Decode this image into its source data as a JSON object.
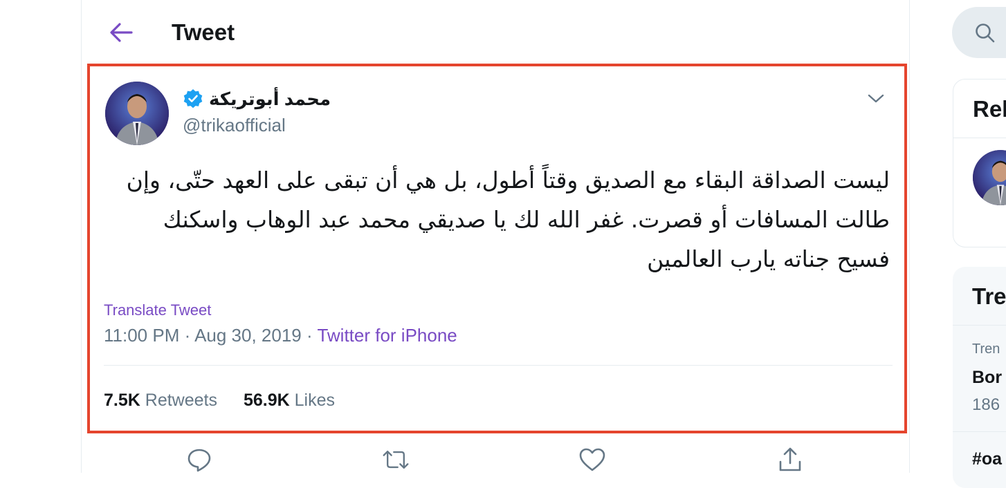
{
  "header": {
    "title": "Tweet"
  },
  "tweet": {
    "author_name": "محمد أبوتريكة",
    "handle": "@trikaofficial",
    "text": "ليست الصداقة البقاء مع الصديق وقتاً أطول، بل هي أن تبقى على العهد حتّى، وإن طالت المسافات أو قصرت.   غفر الله لك يا صديقي محمد عبد الوهاب واسكنك فسيح جناته يارب العالمين",
    "translate_label": "Translate Tweet",
    "time": "11:00 PM",
    "date": "Aug 30, 2019",
    "separator": "·",
    "source": "Twitter for iPhone",
    "retweets_count": "7.5K",
    "retweets_label": "Retweets",
    "likes_count": "56.9K",
    "likes_label": "Likes"
  },
  "sidebar": {
    "relevant_title": "Rel",
    "trends_title": "Tre",
    "trends": [
      {
        "context": "Tren",
        "name": "Bor",
        "count": "186"
      },
      {
        "name": "#oa"
      }
    ]
  },
  "colors": {
    "accent": "#794bc4",
    "highlight_border": "#e5452e",
    "verified": "#1da1f2",
    "secondary_text": "#657786"
  }
}
